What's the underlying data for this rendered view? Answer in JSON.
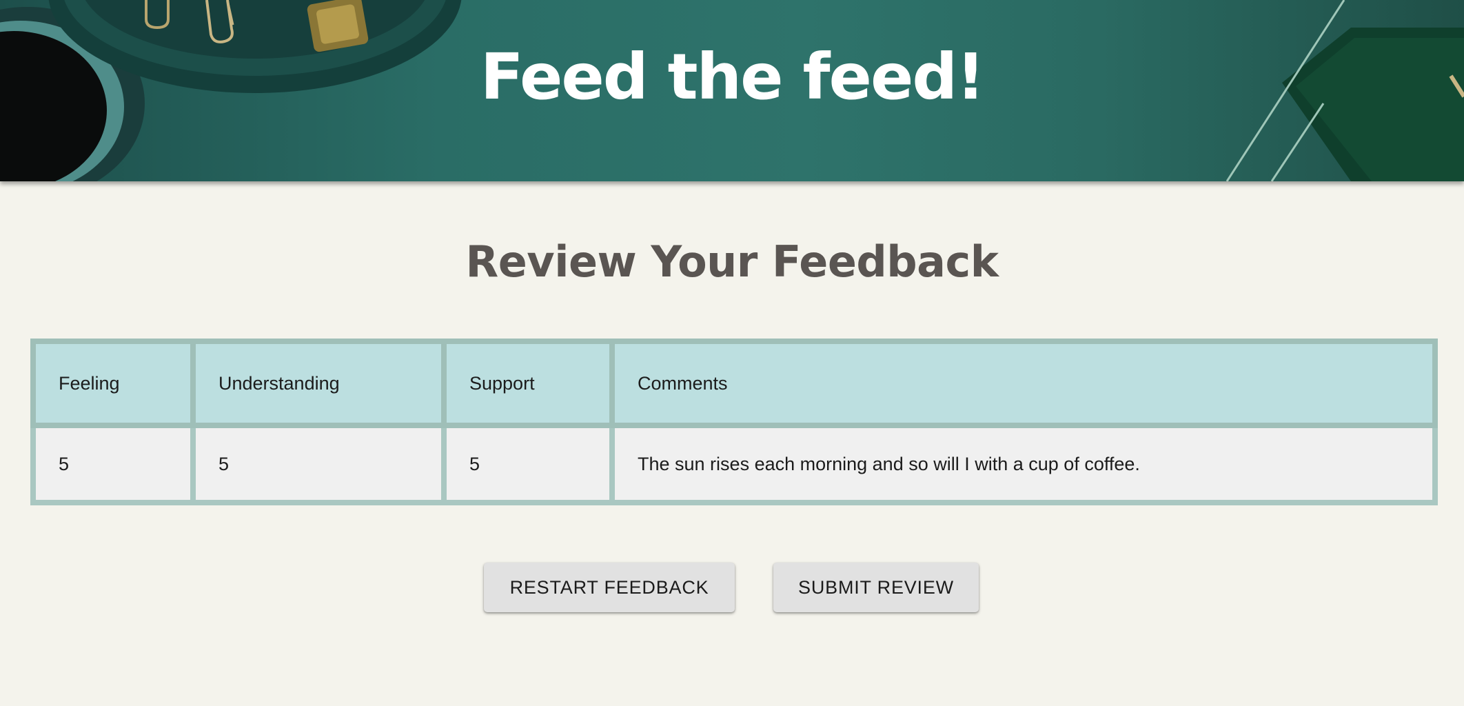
{
  "banner": {
    "title": "Feed the feed!"
  },
  "review": {
    "heading": "Review Your Feedback"
  },
  "table": {
    "headers": [
      "Feeling",
      "Understanding",
      "Support",
      "Comments"
    ],
    "rows": [
      [
        "5",
        "5",
        "5",
        "The sun rises each morning and so will I with a cup of coffee."
      ]
    ]
  },
  "actions": {
    "restart_label": "RESTART FEEDBACK",
    "submit_label": "SUBMIT REVIEW"
  },
  "colors": {
    "background": "#f4f3ec",
    "banner_teal": "#2e736b",
    "table_header": "#bcdfe0",
    "table_border": "#a9c7c1",
    "heading_text": "#5a5552",
    "button_bg": "#e1e1e1"
  }
}
